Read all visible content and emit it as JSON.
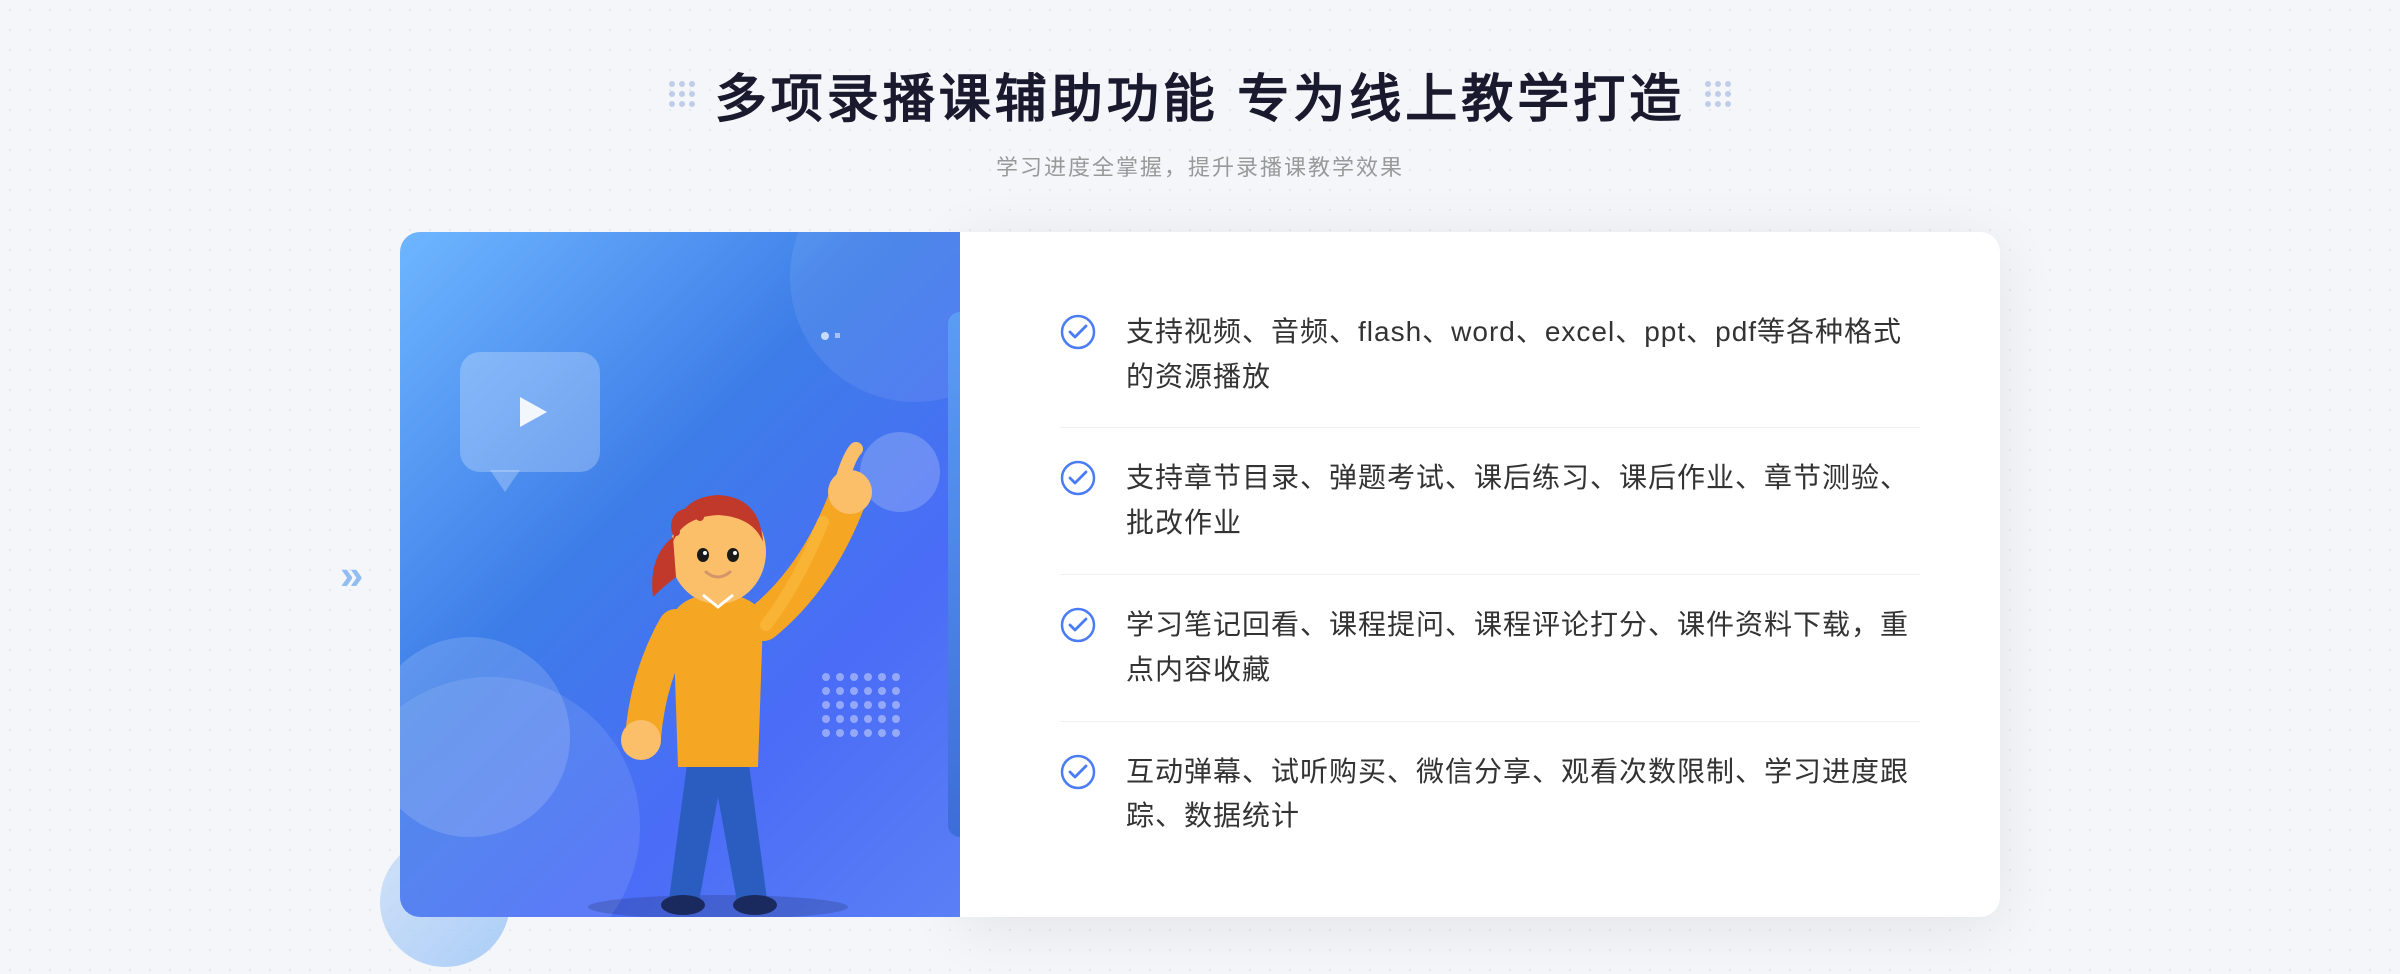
{
  "header": {
    "title": "多项录播课辅助功能 专为线上教学打造",
    "subtitle": "学习进度全掌握，提升录播课教学效果",
    "decorative_dots_label": "decorative-dots"
  },
  "features": [
    {
      "id": 1,
      "text": "支持视频、音频、flash、word、excel、ppt、pdf等各种格式的资源播放"
    },
    {
      "id": 2,
      "text": "支持章节目录、弹题考试、课后练习、课后作业、章节测验、批改作业"
    },
    {
      "id": 3,
      "text": "学习笔记回看、课程提问、课程评论打分、课件资料下载，重点内容收藏"
    },
    {
      "id": 4,
      "text": "互动弹幕、试听购买、微信分享、观看次数限制、学习进度跟踪、数据统计"
    }
  ],
  "colors": {
    "accent_blue": "#4a7cf7",
    "light_blue": "#6eb6ff",
    "text_dark": "#1a1a2e",
    "text_gray": "#999999",
    "text_main": "#333333"
  },
  "icons": {
    "check": "check-circle",
    "play": "play-triangle",
    "chevron_left": "«",
    "decorative_grid": "dot-grid"
  }
}
